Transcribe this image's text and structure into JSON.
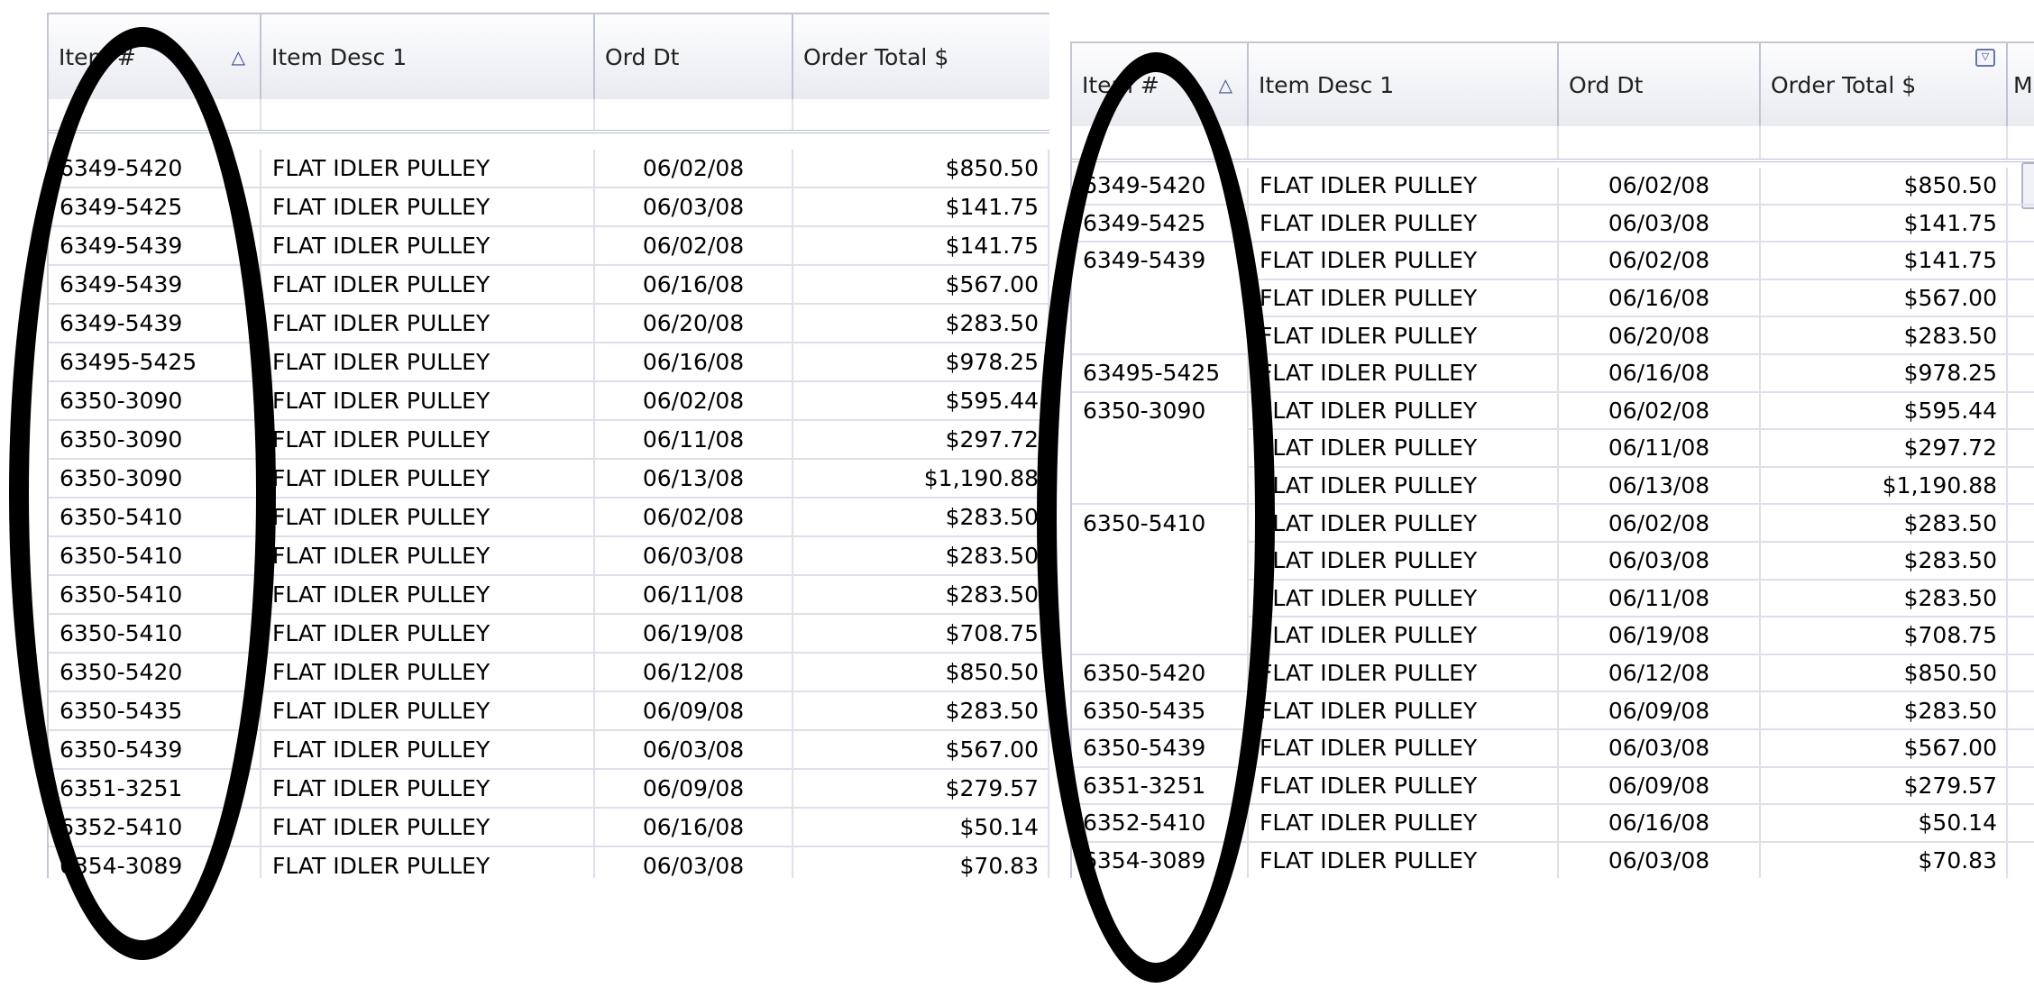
{
  "columns": {
    "item": "Item #",
    "desc": "Item Desc 1",
    "date": "Ord Dt",
    "total": "Order Total $",
    "extra": "M"
  },
  "left_grid": {
    "rows": [
      [
        "6349-5420",
        "FLAT IDLER PULLEY",
        "06/02/08",
        "$850.50"
      ],
      [
        "6349-5425",
        "FLAT IDLER PULLEY",
        "06/03/08",
        "$141.75"
      ],
      [
        "6349-5439",
        "FLAT IDLER PULLEY",
        "06/02/08",
        "$141.75"
      ],
      [
        "6349-5439",
        "FLAT IDLER PULLEY",
        "06/16/08",
        "$567.00"
      ],
      [
        "6349-5439",
        "FLAT IDLER PULLEY",
        "06/20/08",
        "$283.50"
      ],
      [
        "63495-5425",
        "FLAT IDLER PULLEY",
        "06/16/08",
        "$978.25"
      ],
      [
        "6350-3090",
        "FLAT IDLER PULLEY",
        "06/02/08",
        "$595.44"
      ],
      [
        "6350-3090",
        "FLAT IDLER PULLEY",
        "06/11/08",
        "$297.72"
      ],
      [
        "6350-3090",
        "FLAT IDLER PULLEY",
        "06/13/08",
        "$1,190.88"
      ],
      [
        "6350-5410",
        "FLAT IDLER PULLEY",
        "06/02/08",
        "$283.50"
      ],
      [
        "6350-5410",
        "FLAT IDLER PULLEY",
        "06/03/08",
        "$283.50"
      ],
      [
        "6350-5410",
        "FLAT IDLER PULLEY",
        "06/11/08",
        "$283.50"
      ],
      [
        "6350-5410",
        "FLAT IDLER PULLEY",
        "06/19/08",
        "$708.75"
      ],
      [
        "6350-5420",
        "FLAT IDLER PULLEY",
        "06/12/08",
        "$850.50"
      ],
      [
        "6350-5435",
        "FLAT IDLER PULLEY",
        "06/09/08",
        "$283.50"
      ],
      [
        "6350-5439",
        "FLAT IDLER PULLEY",
        "06/03/08",
        "$567.00"
      ],
      [
        "6351-3251",
        "FLAT IDLER PULLEY",
        "06/09/08",
        "$279.57"
      ],
      [
        "6352-5410",
        "FLAT IDLER PULLEY",
        "06/16/08",
        "$50.14"
      ],
      [
        "6354-3089",
        "FLAT IDLER PULLEY",
        "06/03/08",
        "$70.83"
      ]
    ]
  },
  "right_grid": {
    "rows": [
      [
        "6349-5420",
        "FLAT IDLER PULLEY",
        "06/02/08",
        "$850.50"
      ],
      [
        "6349-5425",
        "FLAT IDLER PULLEY",
        "06/03/08",
        "$141.75"
      ],
      [
        "6349-5439",
        "FLAT IDLER PULLEY",
        "06/02/08",
        "$141.75"
      ],
      [
        "",
        "FLAT IDLER PULLEY",
        "06/16/08",
        "$567.00"
      ],
      [
        "",
        "FLAT IDLER PULLEY",
        "06/20/08",
        "$283.50"
      ],
      [
        "63495-5425",
        "FLAT IDLER PULLEY",
        "06/16/08",
        "$978.25"
      ],
      [
        "6350-3090",
        "FLAT IDLER PULLEY",
        "06/02/08",
        "$595.44"
      ],
      [
        "",
        "FLAT IDLER PULLEY",
        "06/11/08",
        "$297.72"
      ],
      [
        "",
        "FLAT IDLER PULLEY",
        "06/13/08",
        "$1,190.88"
      ],
      [
        "6350-5410",
        "FLAT IDLER PULLEY",
        "06/02/08",
        "$283.50"
      ],
      [
        "",
        "FLAT IDLER PULLEY",
        "06/03/08",
        "$283.50"
      ],
      [
        "",
        "FLAT IDLER PULLEY",
        "06/11/08",
        "$283.50"
      ],
      [
        "",
        "FLAT IDLER PULLEY",
        "06/19/08",
        "$708.75"
      ],
      [
        "6350-5420",
        "FLAT IDLER PULLEY",
        "06/12/08",
        "$850.50"
      ],
      [
        "6350-5435",
        "FLAT IDLER PULLEY",
        "06/09/08",
        "$283.50"
      ],
      [
        "6350-5439",
        "FLAT IDLER PULLEY",
        "06/03/08",
        "$567.00"
      ],
      [
        "6351-3251",
        "FLAT IDLER PULLEY",
        "06/09/08",
        "$279.57"
      ],
      [
        "6352-5410",
        "FLAT IDLER PULLEY",
        "06/16/08",
        "$50.14"
      ],
      [
        "6354-3089",
        "FLAT IDLER PULLEY",
        "06/03/08",
        "$70.83"
      ]
    ]
  },
  "icons": {
    "sort_ascending": "sort-ascending-icon",
    "filter": "filter-icon"
  },
  "colors": {
    "header_border": "#a9b1c8",
    "grid_line": "#dde0ea",
    "annotation": "#000000"
  }
}
